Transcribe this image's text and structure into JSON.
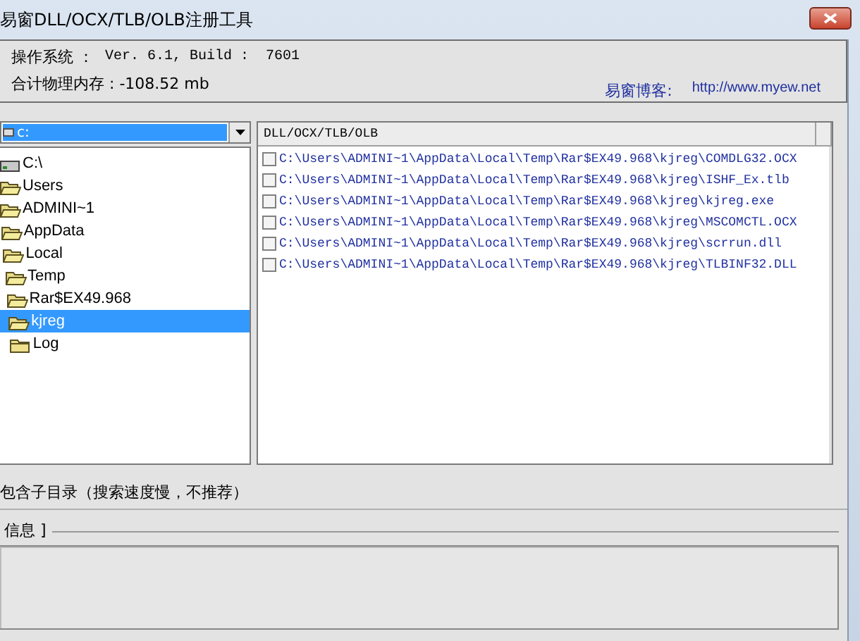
{
  "window": {
    "title": "易窗DLL/OCX/TLB/OLB注册工具"
  },
  "system_info": {
    "os_label": "操作系统 ：",
    "os_value": "Ver. 6.1, Build :  7601",
    "memory": "合计物理内存 : -108.52 mb",
    "blog_label": "易窗博客:",
    "blog_link": "http://www.myew.net"
  },
  "drive_select": {
    "value": "c:"
  },
  "folder_tree": [
    {
      "label": "C:\\",
      "kind": "drive",
      "selected": false,
      "children": [
        {
          "label": "Users",
          "kind": "folder",
          "expanded": true,
          "selected": false,
          "children": [
            {
              "label": "ADMINI~1",
              "kind": "folder",
              "expanded": true,
              "selected": false,
              "children": [
                {
                  "label": "AppData",
                  "kind": "folder",
                  "expanded": true,
                  "selected": false,
                  "children": [
                    {
                      "label": "Local",
                      "kind": "folder",
                      "expanded": true,
                      "selected": false,
                      "children": [
                        {
                          "label": "Temp",
                          "kind": "folder",
                          "expanded": true,
                          "selected": false,
                          "children": [
                            {
                              "label": "Rar$EX49.968",
                              "kind": "folder",
                              "expanded": true,
                              "selected": false,
                              "children": [
                                {
                                  "label": "kjreg",
                                  "kind": "folder",
                                  "expanded": true,
                                  "selected": true,
                                  "children": [
                                    {
                                      "label": "Log",
                                      "kind": "folder",
                                      "expanded": false,
                                      "selected": false
                                    }
                                  ]
                                }
                              ]
                            }
                          ]
                        }
                      ]
                    }
                  ]
                }
              ]
            }
          ]
        }
      ]
    }
  ],
  "file_list": {
    "columns": [
      "DLL/OCX/TLB/OLB"
    ],
    "rows": [
      {
        "path": "C:\\Users\\ADMINI~1\\AppData\\Local\\Temp\\Rar$EX49.968\\kjreg\\COMDLG32.OCX",
        "checked": false
      },
      {
        "path": "C:\\Users\\ADMINI~1\\AppData\\Local\\Temp\\Rar$EX49.968\\kjreg\\ISHF_Ex.tlb",
        "checked": false
      },
      {
        "path": "C:\\Users\\ADMINI~1\\AppData\\Local\\Temp\\Rar$EX49.968\\kjreg\\kjreg.exe",
        "checked": false
      },
      {
        "path": "C:\\Users\\ADMINI~1\\AppData\\Local\\Temp\\Rar$EX49.968\\kjreg\\MSCOMCTL.OCX",
        "checked": false
      },
      {
        "path": "C:\\Users\\ADMINI~1\\AppData\\Local\\Temp\\Rar$EX49.968\\kjreg\\scrrun.dll",
        "checked": false
      },
      {
        "path": "C:\\Users\\ADMINI~1\\AppData\\Local\\Temp\\Rar$EX49.968\\kjreg\\TLBINF32.DLL",
        "checked": false
      }
    ]
  },
  "subdir_option": {
    "label": "包含子目录（搜索速度慢，不推荐）"
  },
  "info_group": {
    "title": "信息 ]"
  }
}
